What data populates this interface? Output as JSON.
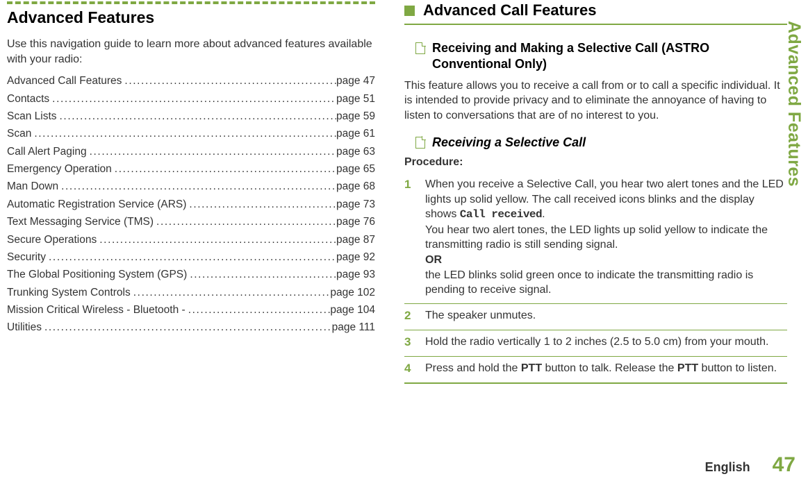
{
  "left": {
    "heading": "Advanced Features",
    "intro": "Use this navigation guide to learn more about advanced features available with your radio:",
    "toc": [
      {
        "label": "Advanced Call Features",
        "page": "page 47"
      },
      {
        "label": "Contacts",
        "page": "page 51"
      },
      {
        "label": "Scan Lists",
        "page": "page 59"
      },
      {
        "label": "Scan",
        "page": "page 61"
      },
      {
        "label": "Call Alert Paging",
        "page": "page 63"
      },
      {
        "label": "Emergency Operation",
        "page": "page 65"
      },
      {
        "label": "Man Down",
        "page": "page 68"
      },
      {
        "label": "Automatic Registration Service (ARS)",
        "page": "page 73"
      },
      {
        "label": "Text Messaging Service (TMS)",
        "page": "page 76"
      },
      {
        "label": "Secure Operations",
        "page": "page 87"
      },
      {
        "label": "Security",
        "page": "page 92"
      },
      {
        "label": "The Global Positioning System (GPS)",
        "page": "page 93"
      },
      {
        "label": "Trunking System Controls",
        "page": "page 102"
      },
      {
        "label": "Mission Critical Wireless - Bluetooth -",
        "page": "page 104"
      },
      {
        "label": "Utilities",
        "page": "page 111"
      }
    ]
  },
  "right": {
    "section_heading": "Advanced Call Features",
    "sub1": {
      "title": "Receiving and Making a Selective Call (ASTRO Conventional Only)",
      "body": "This feature allows you to receive a call from or to call a specific individual. It is intended to provide privacy and to eliminate the annoyance of having to listen to conversations that are of no interest to you."
    },
    "sub2": {
      "title": "Receiving a Selective Call",
      "procedure_label": "Procedure:",
      "steps": {
        "s1_a": "When you receive a Selective Call, you hear two alert tones and the LED lights up solid yellow. The call received icons blinks and the display shows ",
        "s1_code": "Call received",
        "s1_b": ".",
        "s1_c": "You hear two alert tones, the LED lights up solid yellow to indicate the transmitting radio is still sending signal.",
        "s1_or": "OR",
        "s1_d": "the LED blinks solid green once to indicate the transmitting radio is pending to receive signal.",
        "s2": "The speaker unmutes.",
        "s3": "Hold the radio vertically 1 to 2 inches (2.5 to 5.0 cm) from your mouth.",
        "s4_a": "Press and hold the ",
        "s4_b1": "PTT",
        "s4_c": " button to talk. Release the ",
        "s4_b2": "PTT",
        "s4_d": " button to listen."
      }
    }
  },
  "side_tab": "Advanced Features",
  "footer": {
    "lang": "English",
    "pagenum": "47"
  }
}
